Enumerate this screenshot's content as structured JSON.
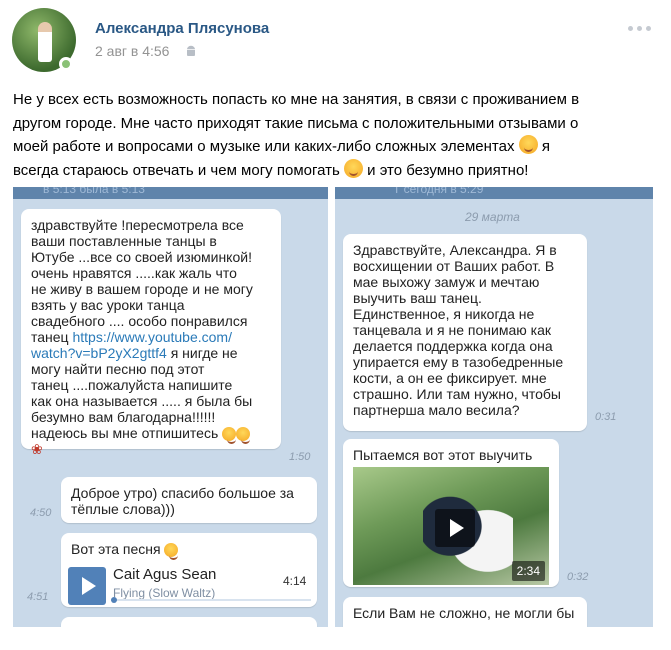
{
  "post": {
    "author": "Александра Плясунова",
    "time": "2 авг в 4:56",
    "platform_icon": "android-icon",
    "text_lines": [
      "Не у всех есть возможность попасть ко мне на занятия, в связи с проживанием в",
      "другом городе. Мне часто приходят такие письма с положительными отзывами о",
      "моей работе и вопросами о музыке или каких-либо сложных элементах",
      "я",
      "всегда стараюсь отвечать и чем могу помогать",
      "и это безумно приятно!"
    ]
  },
  "shot1": {
    "top_partial": "в 5:13        была в 5:13",
    "msg1_lines": [
      "здравствуйте !пересмотрела все",
      "ваши поставленные танцы в",
      "Ютубе ...все со своей изюминкой!",
      "очень нравятся .....как жаль что",
      "не живу в вашем городе и не могу",
      "взять у вас уроки танца",
      "свадебного .... особо понравился",
      "танец"
    ],
    "msg1_link": "https://www.youtube.com/",
    "msg1_link2": "watch?v=bP2yX2gttf4",
    "msg1_after_link": " я нигде не",
    "msg1_lines2": [
      "могу найти песню под этот",
      "танец ....пожалуйста напишите",
      "как она называется ..... я была бы",
      "безумно вам благодарна!!!!!!",
      "надеюсь вы мне отпишитесь"
    ],
    "msg1_time": "1:50",
    "msg2_lines": [
      "Доброе утро) спасибо большое за",
      "тёплые слова)))"
    ],
    "msg2_time": "4:50",
    "msg3_title": "Вот эта песня",
    "audio_artist": "Cait Agus Sean",
    "audio_title": "Flying (Slow Waltz)",
    "audio_duration": "4:14",
    "msg3_time": "4:51"
  },
  "shot2": {
    "top_partial": "Т сегодня в 5:29",
    "date": "29 марта",
    "msg1_lines": [
      "Здравствуйте, Александра. Я в",
      "восхищении от Ваших работ. В",
      "мае выхожу замуж и мечтаю",
      "выучить ваш танец.",
      "Единственное, я никогда не",
      "танцевала и я не понимаю как",
      "делается поддержка когда она",
      "упирается ему в тазобедренные",
      "кости, а он ее фиксирует. мне",
      "страшно. Или там нужно, чтобы",
      "партнерша мало весила?"
    ],
    "msg1_time": "0:31",
    "msg2_title": "Пытаемся вот этот выучить",
    "video_duration": "2:34",
    "msg2_time": "0:32",
    "msg3_partial": "Если Вам не сложно, не могли бы"
  },
  "colors": {
    "author": "#2a5885",
    "muted": "#939393",
    "chat_bg": "#c9d9e9",
    "accent": "#5181b8"
  }
}
